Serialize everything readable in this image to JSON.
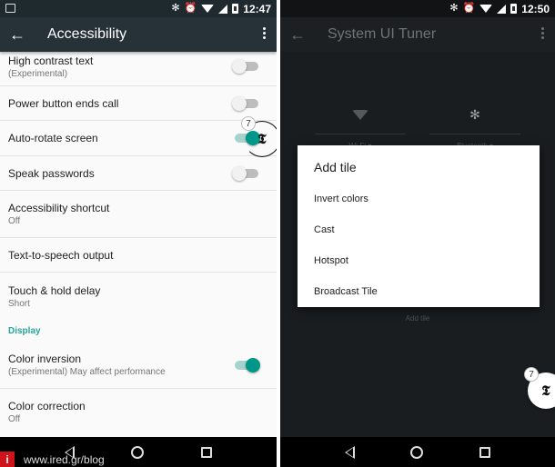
{
  "left_screen": {
    "status_bar": {
      "time": "12:47",
      "icons": [
        "image-notification-icon",
        "bluetooth-icon",
        "alarm-icon",
        "wifi-icon",
        "signal-icon",
        "battery-icon"
      ]
    },
    "toolbar": {
      "title": "Accessibility",
      "back_icon": "←"
    },
    "items": [
      {
        "title": "High contrast text",
        "subtitle": "(Experimental)",
        "toggle": "off"
      },
      {
        "title": "Power button ends call",
        "subtitle": "",
        "toggle": "off"
      },
      {
        "title": "Auto-rotate screen",
        "subtitle": "",
        "toggle": "on"
      },
      {
        "title": "Speak passwords",
        "subtitle": "",
        "toggle": "off"
      },
      {
        "title": "Accessibility shortcut",
        "subtitle": "Off"
      },
      {
        "title": "Text-to-speech output",
        "subtitle": ""
      },
      {
        "title": "Touch & hold delay",
        "subtitle": "Short"
      }
    ],
    "section": "Display",
    "display_items": [
      {
        "title": "Color inversion",
        "subtitle": "(Experimental) May affect performance",
        "toggle": "on"
      },
      {
        "title": "Color correction",
        "subtitle": "Off"
      }
    ],
    "bubble": {
      "glyph": "𝕿",
      "badge": "7"
    },
    "watermark": {
      "logo": "i",
      "text": "www.ired.gr/blog",
      "color": "#d0121b"
    }
  },
  "right_screen": {
    "status_bar": {
      "time": "12:50",
      "icons": [
        "bluetooth-icon",
        "alarm-icon",
        "wifi-icon",
        "signal-icon",
        "battery-icon"
      ]
    },
    "toolbar": {
      "title": "System UI Tuner",
      "back_icon": "←"
    },
    "tiles": [
      {
        "label": "Wi-Fi ▾"
      },
      {
        "label": "Bluetooth ▾",
        "icon": "✻"
      }
    ],
    "add_tile_label": "Add tile",
    "dialog": {
      "title": "Add tile",
      "options": [
        "Invert colors",
        "Cast",
        "Hotspot",
        "Broadcast Tile"
      ]
    },
    "bubble": {
      "glyph": "𝕿",
      "badge": "7"
    }
  },
  "colors": {
    "accent": "#009688",
    "section_header": "#26a69a",
    "toolbar_left": "#263238"
  }
}
